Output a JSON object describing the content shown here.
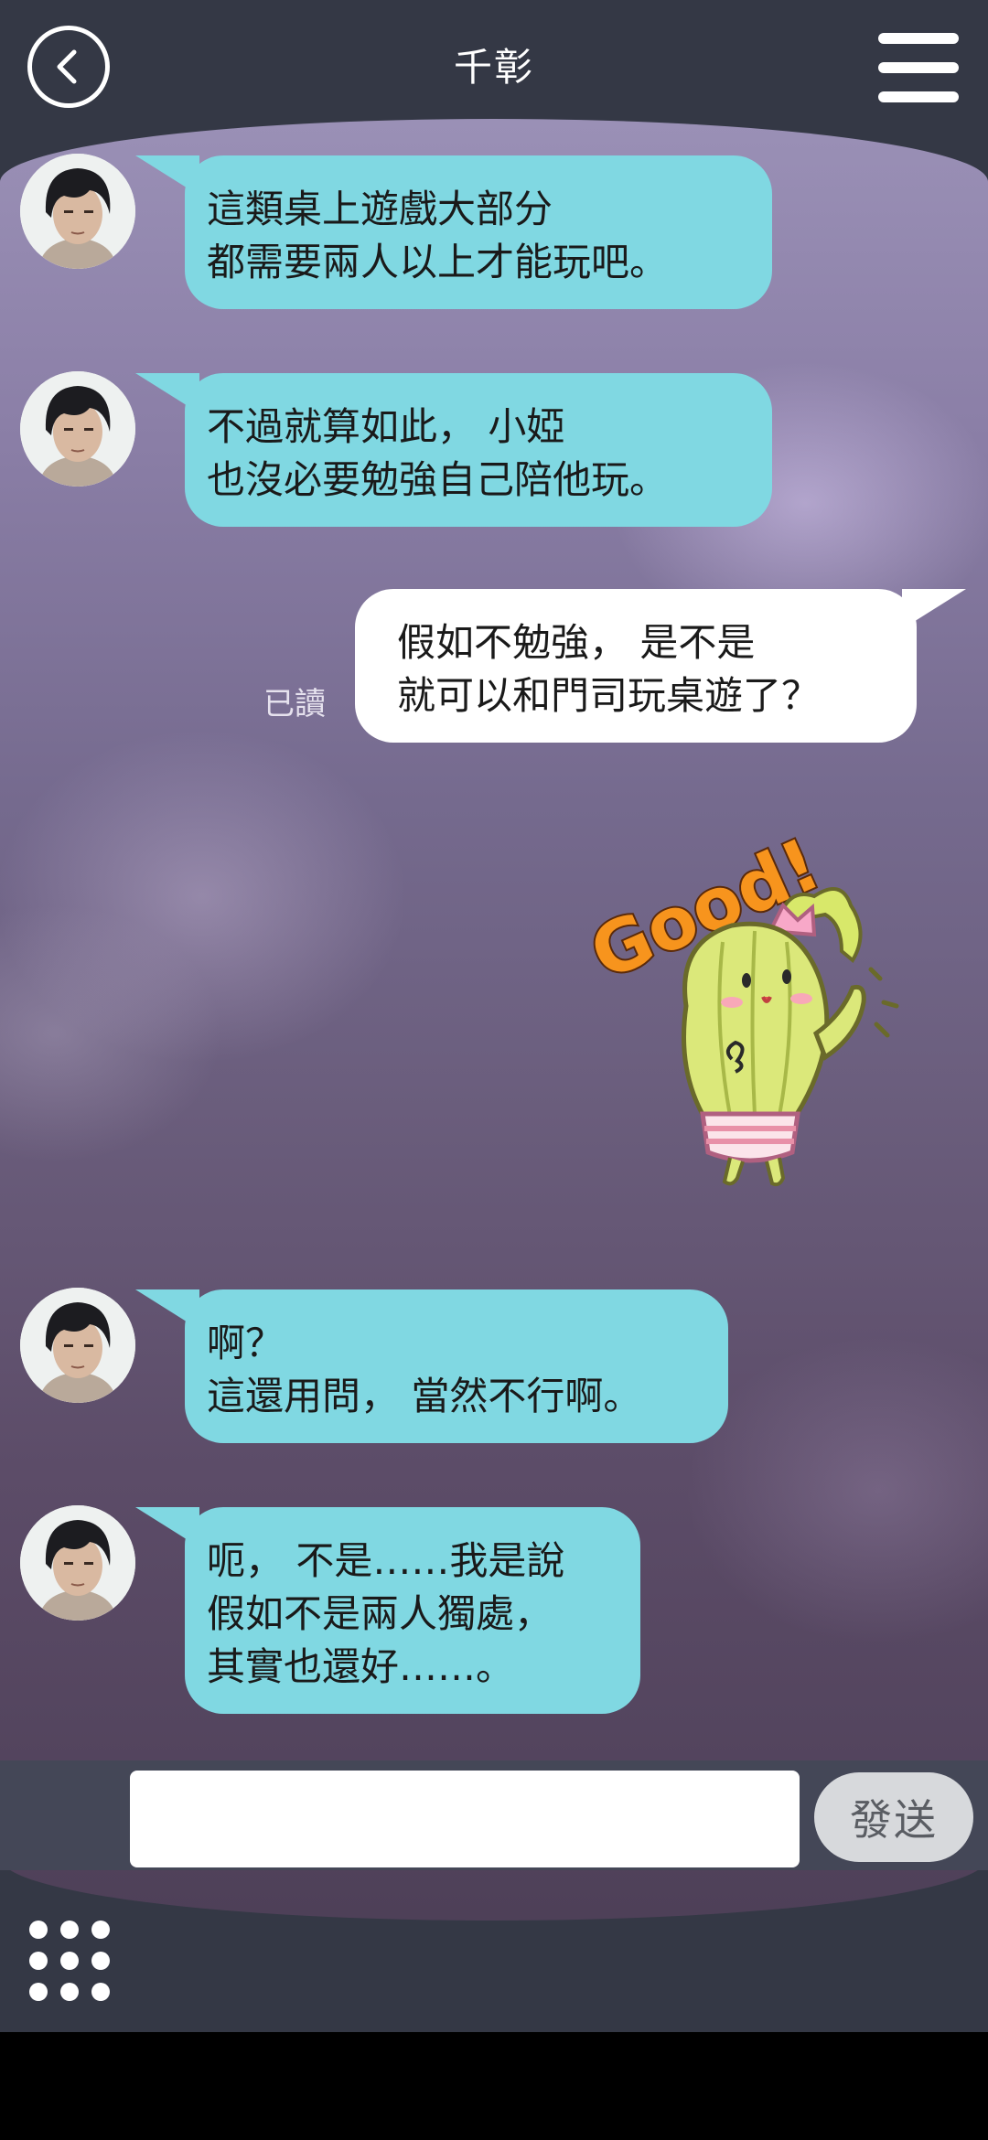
{
  "header": {
    "title": "千彰"
  },
  "messages": [
    {
      "side": "in",
      "lines": [
        "這類桌上遊戲大部分",
        "都需要兩人以上才能玩吧。"
      ]
    },
    {
      "side": "in",
      "lines": [
        "不過就算如此， 小婭",
        "也沒必要勉強自己陪他玩。"
      ]
    },
    {
      "side": "out",
      "lines": [
        "假如不勉強， 是不是",
        "就可以和門司玩桌遊了？"
      ],
      "status": "已讀"
    },
    {
      "side": "in",
      "lines": [
        "啊？",
        "這還用問， 當然不行啊。"
      ]
    },
    {
      "side": "in",
      "lines": [
        "呃， 不是……我是說",
        "假如不是兩人獨處，",
        "其實也還好……。"
      ]
    }
  ],
  "sticker": {
    "text": "Good!",
    "icon": "cactus-good-sticker"
  },
  "composer": {
    "input_value": "",
    "input_placeholder": "",
    "send_label": "發送"
  },
  "icons": {
    "back": "back-arrow-icon",
    "menu": "hamburger-menu-icon",
    "more": "nine-dot-grid-icon"
  },
  "colors": {
    "incoming_bubble": "#80d8e2",
    "outgoing_bubble": "#ffffff",
    "bar": "#343845"
  }
}
